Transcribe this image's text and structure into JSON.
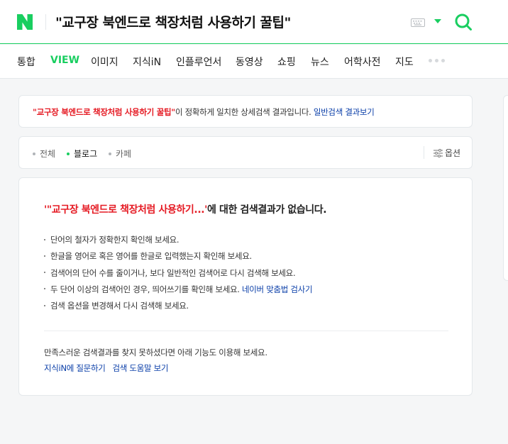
{
  "header": {
    "query": "\"교구장 북엔드로 책장처럼 사용하기 꿀팁\"",
    "brand_color": "#19ce60"
  },
  "nav": {
    "items": [
      {
        "label": "통합",
        "active": false
      },
      {
        "label": "VIEW",
        "active": true
      },
      {
        "label": "이미지",
        "active": false
      },
      {
        "label": "지식iN",
        "active": false
      },
      {
        "label": "인플루언서",
        "active": false
      },
      {
        "label": "동영상",
        "active": false
      },
      {
        "label": "쇼핑",
        "active": false
      },
      {
        "label": "뉴스",
        "active": false
      },
      {
        "label": "어학사전",
        "active": false
      },
      {
        "label": "지도",
        "active": false
      }
    ]
  },
  "notice": {
    "query": "\"교구장 북엔드로 책장처럼 사용하기 꿀팁\"",
    "text": "이 정확하게 일치한 상세검색 결과입니다.",
    "link": "일반검색 결과보기"
  },
  "filter": {
    "items": [
      {
        "label": "전체",
        "active": false
      },
      {
        "label": "블로그",
        "active": true
      },
      {
        "label": "카페",
        "active": false
      }
    ],
    "option_label": "옵션"
  },
  "result": {
    "title_query": "'\"교구장 북엔드로 책장처럼 사용하기...'",
    "title_suffix": "에 대한 검색결과가 없습니다.",
    "tips": [
      "단어의 철자가 정확한지 확인해 보세요.",
      "한글을 영어로 혹은 영어를 한글로 입력했는지 확인해 보세요.",
      "검색어의 단어 수를 줄이거나, 보다 일반적인 검색어로 다시 검색해 보세요.",
      "두 단어 이상의 검색어인 경우, 띄어쓰기를 확인해 보세요.",
      "검색 옵션을 변경해서 다시 검색해 보세요."
    ],
    "spell_link": "네이버 맞춤법 검사기",
    "help_text": "만족스러운 검색결과를 찾지 못하셨다면 아래 기능도 이용해 보세요.",
    "help_links": [
      "지식iN에 질문하기",
      "검색 도움말 보기"
    ]
  }
}
